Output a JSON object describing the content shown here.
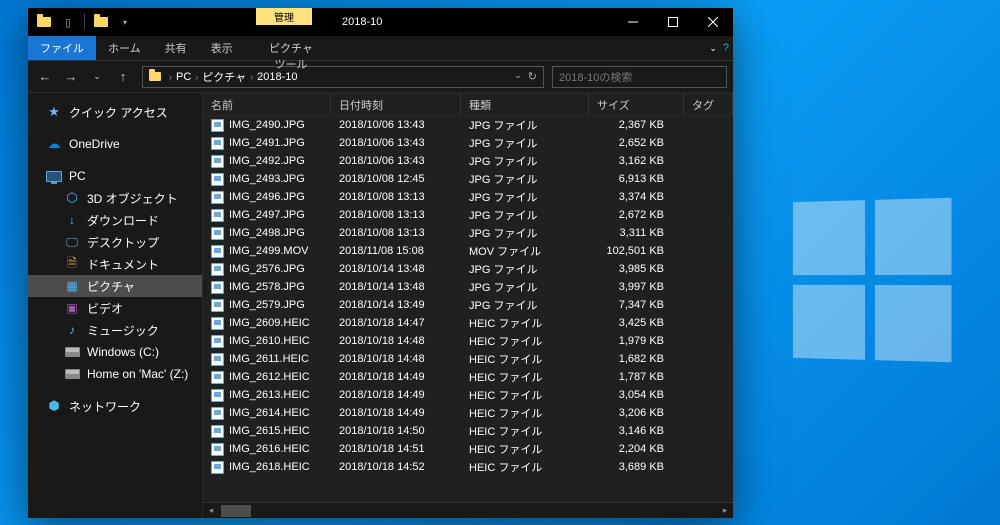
{
  "titlebar": {
    "management": "管理",
    "title": "2018-10"
  },
  "ribbon": {
    "file": "ファイル",
    "home": "ホーム",
    "share": "共有",
    "view": "表示",
    "picture_tools": "ピクチャ ツール"
  },
  "nav": {
    "pc": "PC",
    "pictures": "ピクチャ",
    "folder": "2018-10",
    "search_placeholder": "2018-10の検索"
  },
  "tree": {
    "quick_access": "クイック アクセス",
    "onedrive": "OneDrive",
    "pc": "PC",
    "objects_3d": "3D オブジェクト",
    "downloads": "ダウンロード",
    "desktop": "デスクトップ",
    "documents": "ドキュメント",
    "pictures": "ピクチャ",
    "videos": "ビデオ",
    "music": "ミュージック",
    "windows_c": "Windows (C:)",
    "home_mac": "Home on 'Mac' (Z:)",
    "network": "ネットワーク"
  },
  "headers": {
    "name": "名前",
    "date": "日付時刻",
    "type": "種類",
    "size": "サイズ",
    "tag": "タグ"
  },
  "files": [
    {
      "name": "IMG_2490.JPG",
      "date": "2018/10/06 13:43",
      "type": "JPG ファイル",
      "size": "2,367 KB"
    },
    {
      "name": "IMG_2491.JPG",
      "date": "2018/10/06 13:43",
      "type": "JPG ファイル",
      "size": "2,652 KB"
    },
    {
      "name": "IMG_2492.JPG",
      "date": "2018/10/06 13:43",
      "type": "JPG ファイル",
      "size": "3,162 KB"
    },
    {
      "name": "IMG_2493.JPG",
      "date": "2018/10/08 12:45",
      "type": "JPG ファイル",
      "size": "6,913 KB"
    },
    {
      "name": "IMG_2496.JPG",
      "date": "2018/10/08 13:13",
      "type": "JPG ファイル",
      "size": "3,374 KB"
    },
    {
      "name": "IMG_2497.JPG",
      "date": "2018/10/08 13:13",
      "type": "JPG ファイル",
      "size": "2,672 KB"
    },
    {
      "name": "IMG_2498.JPG",
      "date": "2018/10/08 13:13",
      "type": "JPG ファイル",
      "size": "3,311 KB"
    },
    {
      "name": "IMG_2499.MOV",
      "date": "2018/11/08 15:08",
      "type": "MOV ファイル",
      "size": "102,501 KB"
    },
    {
      "name": "IMG_2576.JPG",
      "date": "2018/10/14 13:48",
      "type": "JPG ファイル",
      "size": "3,985 KB"
    },
    {
      "name": "IMG_2578.JPG",
      "date": "2018/10/14 13:48",
      "type": "JPG ファイル",
      "size": "3,997 KB"
    },
    {
      "name": "IMG_2579.JPG",
      "date": "2018/10/14 13:49",
      "type": "JPG ファイル",
      "size": "7,347 KB"
    },
    {
      "name": "IMG_2609.HEIC",
      "date": "2018/10/18 14:47",
      "type": "HEIC ファイル",
      "size": "3,425 KB"
    },
    {
      "name": "IMG_2610.HEIC",
      "date": "2018/10/18 14:48",
      "type": "HEIC ファイル",
      "size": "1,979 KB"
    },
    {
      "name": "IMG_2611.HEIC",
      "date": "2018/10/18 14:48",
      "type": "HEIC ファイル",
      "size": "1,682 KB"
    },
    {
      "name": "IMG_2612.HEIC",
      "date": "2018/10/18 14:49",
      "type": "HEIC ファイル",
      "size": "1,787 KB"
    },
    {
      "name": "IMG_2613.HEIC",
      "date": "2018/10/18 14:49",
      "type": "HEIC ファイル",
      "size": "3,054 KB"
    },
    {
      "name": "IMG_2614.HEIC",
      "date": "2018/10/18 14:49",
      "type": "HEIC ファイル",
      "size": "3,206 KB"
    },
    {
      "name": "IMG_2615.HEIC",
      "date": "2018/10/18 14:50",
      "type": "HEIC ファイル",
      "size": "3,146 KB"
    },
    {
      "name": "IMG_2616.HEIC",
      "date": "2018/10/18 14:51",
      "type": "HEIC ファイル",
      "size": "2,204 KB"
    },
    {
      "name": "IMG_2618.HEIC",
      "date": "2018/10/18 14:52",
      "type": "HEIC ファイル",
      "size": "3,689 KB"
    }
  ]
}
